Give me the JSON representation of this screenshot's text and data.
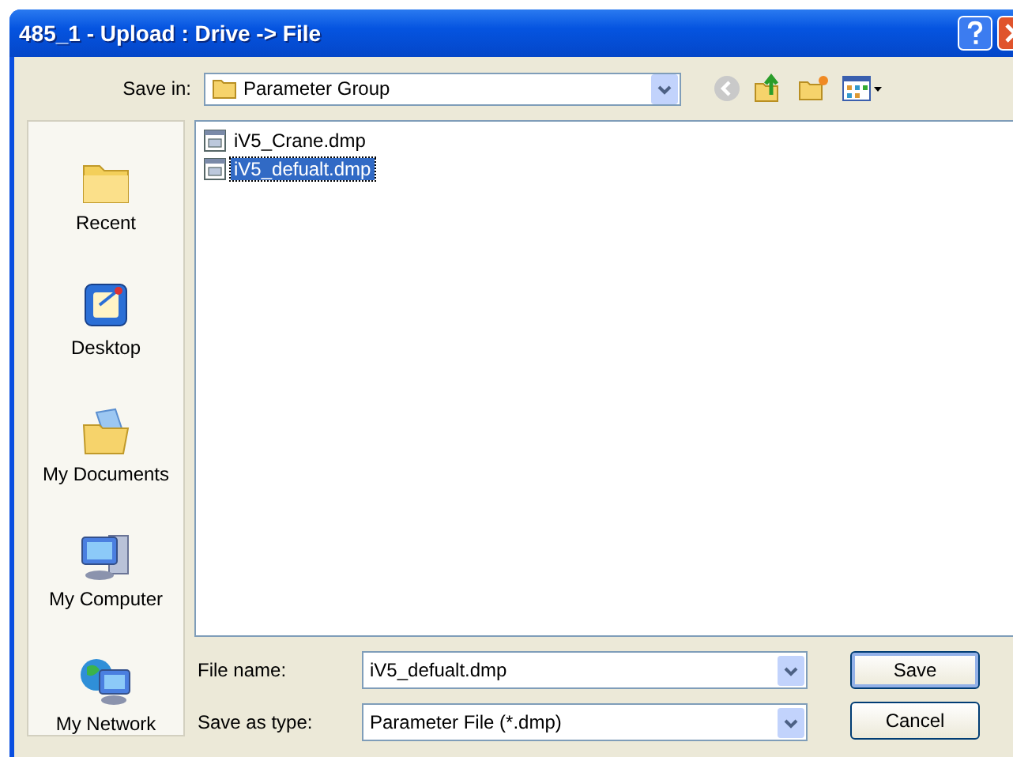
{
  "window": {
    "title": "485_1 - Upload : Drive -> File"
  },
  "save_in": {
    "label": "Save in:",
    "value": "Parameter Group"
  },
  "places": [
    {
      "label": "Recent",
      "kind": "recent"
    },
    {
      "label": "Desktop",
      "kind": "desktop"
    },
    {
      "label": "My Documents",
      "kind": "documents"
    },
    {
      "label": "My Computer",
      "kind": "computer"
    },
    {
      "label": "My Network",
      "kind": "network"
    }
  ],
  "files": [
    {
      "name": "iV5_Crane.dmp",
      "selected": false
    },
    {
      "name": "iV5_defualt.dmp",
      "selected": true
    }
  ],
  "file_name": {
    "label": "File name:",
    "value": "iV5_defualt.dmp"
  },
  "save_as_type": {
    "label": "Save as type:",
    "value": "Parameter File (*.dmp)"
  },
  "buttons": [
    {
      "label": "Save",
      "default": true
    },
    {
      "label": "Cancel",
      "default": false
    }
  ]
}
